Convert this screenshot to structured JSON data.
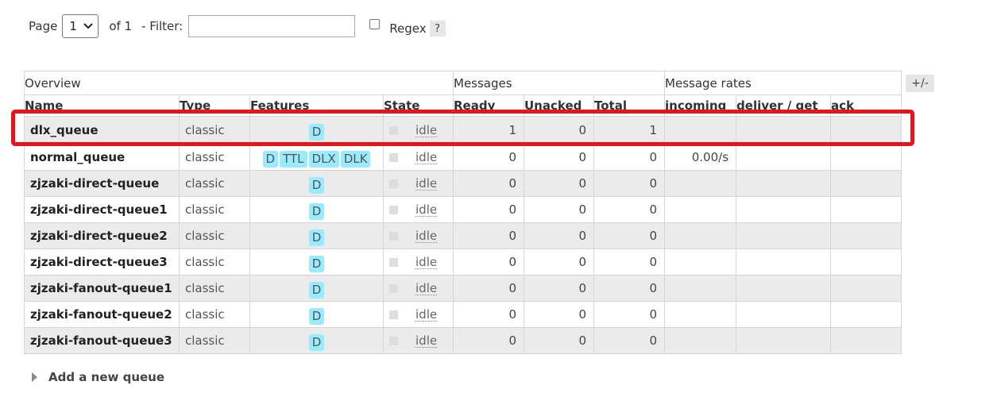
{
  "pagination": {
    "page_label": "Page",
    "page_value": "1",
    "of_label": "of 1",
    "filter_label": "- Filter:",
    "filter_value": "",
    "regex_label": "Regex",
    "help_label": "?"
  },
  "table": {
    "group_headers": [
      "Overview",
      "Messages",
      "Message rates"
    ],
    "toggle_columns_label": "+/-",
    "columns": [
      "Name",
      "Type",
      "Features",
      "State",
      "Ready",
      "Unacked",
      "Total",
      "incoming",
      "deliver / get",
      "ack"
    ],
    "rows": [
      {
        "name": "dlx_queue",
        "type": "classic",
        "features": [
          "D"
        ],
        "state": "idle",
        "ready": "1",
        "unacked": "0",
        "total": "1",
        "incoming": "",
        "deliver_get": "",
        "ack": ""
      },
      {
        "name": "normal_queue",
        "type": "classic",
        "features": [
          "D",
          "TTL",
          "DLX",
          "DLK"
        ],
        "state": "idle",
        "ready": "0",
        "unacked": "0",
        "total": "0",
        "incoming": "0.00/s",
        "deliver_get": "",
        "ack": ""
      },
      {
        "name": "zjzaki-direct-queue",
        "type": "classic",
        "features": [
          "D"
        ],
        "state": "idle",
        "ready": "0",
        "unacked": "0",
        "total": "0",
        "incoming": "",
        "deliver_get": "",
        "ack": ""
      },
      {
        "name": "zjzaki-direct-queue1",
        "type": "classic",
        "features": [
          "D"
        ],
        "state": "idle",
        "ready": "0",
        "unacked": "0",
        "total": "0",
        "incoming": "",
        "deliver_get": "",
        "ack": ""
      },
      {
        "name": "zjzaki-direct-queue2",
        "type": "classic",
        "features": [
          "D"
        ],
        "state": "idle",
        "ready": "0",
        "unacked": "0",
        "total": "0",
        "incoming": "",
        "deliver_get": "",
        "ack": ""
      },
      {
        "name": "zjzaki-direct-queue3",
        "type": "classic",
        "features": [
          "D"
        ],
        "state": "idle",
        "ready": "0",
        "unacked": "0",
        "total": "0",
        "incoming": "",
        "deliver_get": "",
        "ack": ""
      },
      {
        "name": "zjzaki-fanout-queue1",
        "type": "classic",
        "features": [
          "D"
        ],
        "state": "idle",
        "ready": "0",
        "unacked": "0",
        "total": "0",
        "incoming": "",
        "deliver_get": "",
        "ack": ""
      },
      {
        "name": "zjzaki-fanout-queue2",
        "type": "classic",
        "features": [
          "D"
        ],
        "state": "idle",
        "ready": "0",
        "unacked": "0",
        "total": "0",
        "incoming": "",
        "deliver_get": "",
        "ack": ""
      },
      {
        "name": "zjzaki-fanout-queue3",
        "type": "classic",
        "features": [
          "D"
        ],
        "state": "idle",
        "ready": "0",
        "unacked": "0",
        "total": "0",
        "incoming": "",
        "deliver_get": "",
        "ack": ""
      }
    ]
  },
  "add_queue": {
    "label": "Add a new queue",
    "expander_icon": "triangle-right-icon"
  },
  "colors": {
    "feature_tag_bg": "#99ebff",
    "highlight_border": "#e8141c",
    "row_alt_bg": "#ebebeb"
  }
}
